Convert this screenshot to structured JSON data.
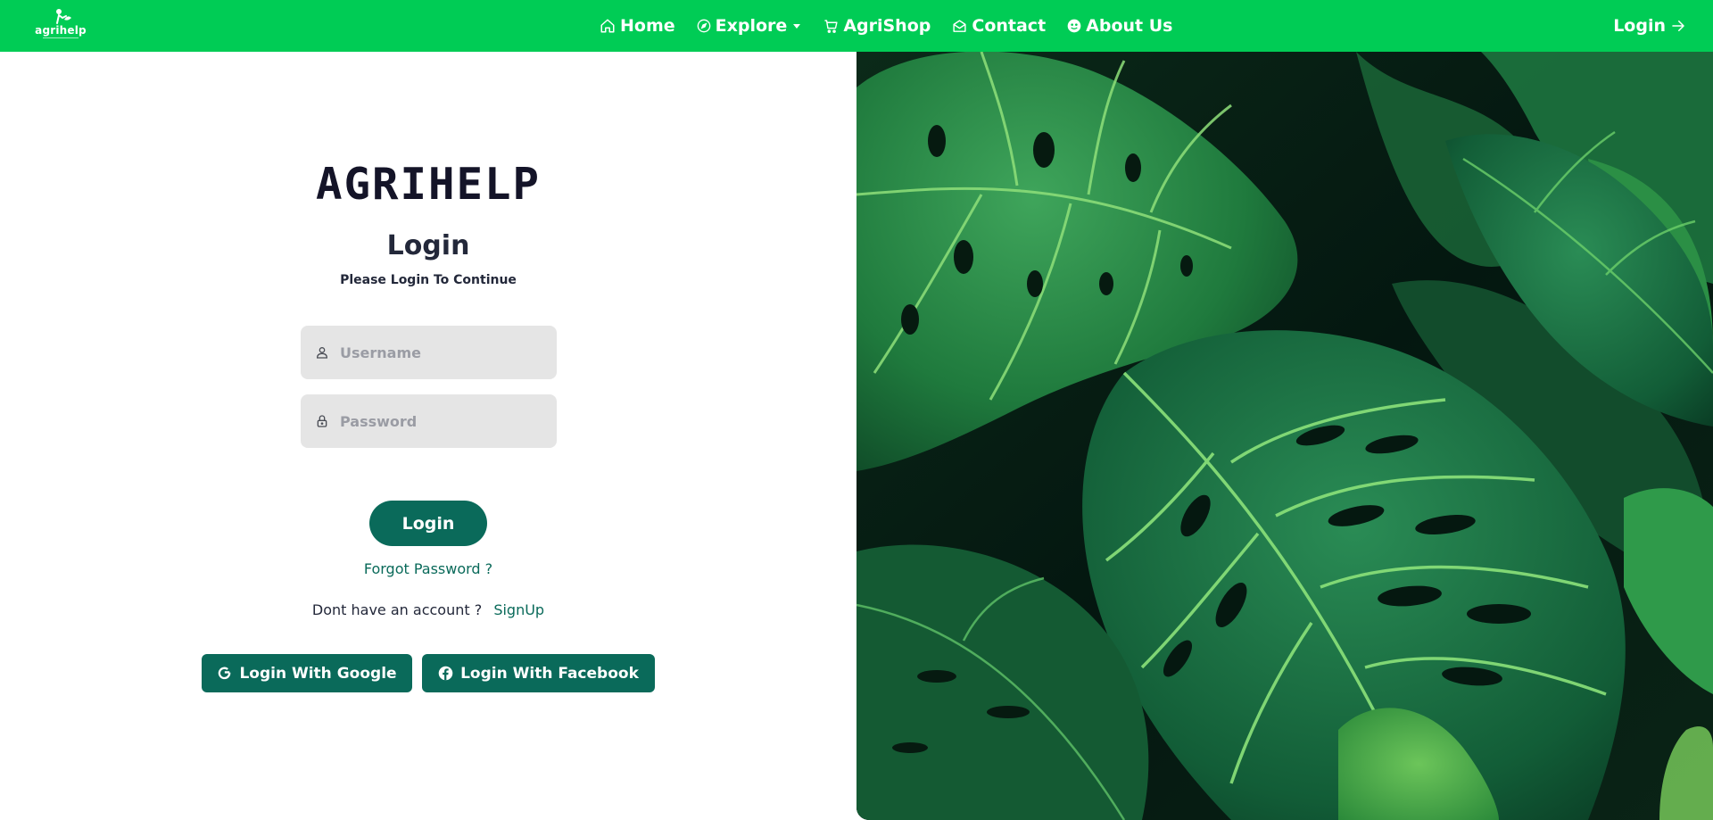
{
  "navbar": {
    "logo_text": "agrihelp",
    "items": [
      {
        "label": "Home",
        "icon": "home-icon"
      },
      {
        "label": "Explore",
        "icon": "compass-icon",
        "dropdown": true
      },
      {
        "label": "AgriShop",
        "icon": "cart-icon"
      },
      {
        "label": "Contact",
        "icon": "mail-icon"
      },
      {
        "label": "About Us",
        "icon": "smile-icon"
      }
    ],
    "login_label": "Login",
    "login_icon": "arrow-right-icon"
  },
  "form": {
    "brand": "AGRIHELP",
    "title": "Login",
    "subtitle": "Please Login To Continue",
    "username_placeholder": "Username",
    "password_placeholder": "Password",
    "login_button": "Login",
    "forgot_password": "Forgot Password ?",
    "no_account_text": "Dont have an account ?",
    "signup_link": "SignUp",
    "google_button": "Login With Google",
    "facebook_button": "Login With Facebook"
  },
  "hero_image": {
    "subject": "monstera-leaves-photo"
  },
  "colors": {
    "navbar": "#00cc55",
    "primary": "#0a6a5a",
    "input_bg": "#e5e5e5",
    "text": "#23283a"
  }
}
